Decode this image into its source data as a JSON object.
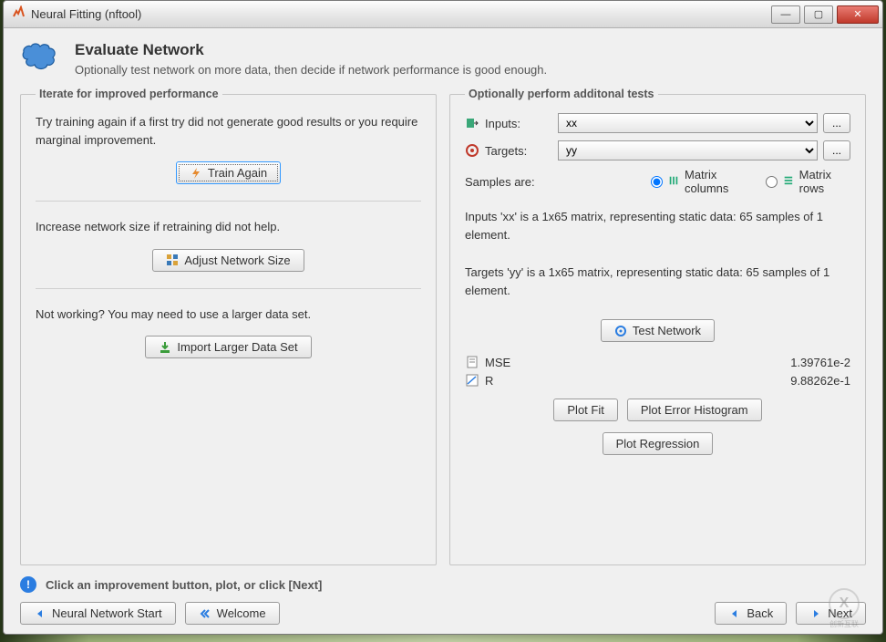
{
  "window": {
    "title": "Neural Fitting (nftool)"
  },
  "header": {
    "title": "Evaluate Network",
    "subtitle": "Optionally test network on more data, then decide if network performance is good enough."
  },
  "left": {
    "legend": "Iterate for improved performance",
    "sec1_text": "Try training again if a first try did not generate good results or you require marginal improvement.",
    "train_again": "Train Again",
    "sec2_text": "Increase network size if retraining did not help.",
    "adjust_size": "Adjust Network Size",
    "sec3_text": "Not working? You may need to use a larger data set.",
    "import_data": "Import Larger Data Set"
  },
  "right": {
    "legend": "Optionally perform additonal tests",
    "inputs_label": "Inputs:",
    "inputs_value": "xx",
    "targets_label": "Targets:",
    "targets_value": "yy",
    "browse": "...",
    "samples_label": "Samples are:",
    "matrix_columns": "Matrix columns",
    "matrix_rows": "Matrix rows",
    "desc_inputs": "Inputs 'xx' is a 1x65 matrix, representing static data: 65 samples of 1 element.",
    "desc_targets": "Targets 'yy' is a 1x65 matrix, representing static data: 65 samples of 1 element.",
    "test_network": "Test Network",
    "mse_label": "MSE",
    "mse_value": "1.39761e-2",
    "r_label": "R",
    "r_value": "9.88262e-1",
    "plot_fit": "Plot Fit",
    "plot_hist": "Plot Error Histogram",
    "plot_reg": "Plot Regression"
  },
  "footer": {
    "hint": "Click an improvement button, plot, or click [Next]",
    "nn_start": "Neural Network Start",
    "welcome": "Welcome",
    "back": "Back",
    "next": "Next"
  },
  "watermark": {
    "brand": "创新互联"
  }
}
